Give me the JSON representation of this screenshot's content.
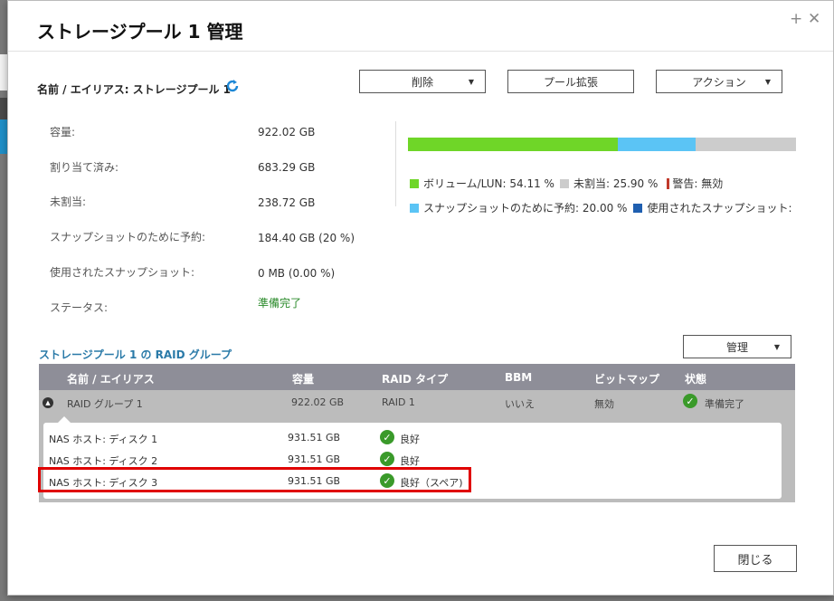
{
  "dialog": {
    "title": "ストレージプール 1 管理",
    "alias_line": "名前 / エイリアス: ストレージプール 1"
  },
  "toolbar": {
    "delete_label": "削除",
    "expand_label": "プール拡張",
    "action_label": "アクション"
  },
  "info": [
    {
      "label": "容量:",
      "value": "922.02 GB"
    },
    {
      "label": "割り当て済み:",
      "value": "683.29 GB"
    },
    {
      "label": "未割当:",
      "value": "238.72 GB"
    },
    {
      "label": "スナップショットのために予約:",
      "value": "184.40 GB (20 %)"
    },
    {
      "label": "使用されたスナップショット:",
      "value": "0 MB (0.00 %)"
    },
    {
      "label": "ステータス:",
      "value": "準備完了"
    }
  ],
  "usage_bar": {
    "volume_fraction": 0.5411,
    "unallocated_fraction": 0.259,
    "snapshot_reserved_fraction": 0.2,
    "colors": {
      "volume": "#6fd628",
      "snapshot_reserved": "#5bc4f5",
      "unallocated": "#cccccc",
      "warning": "#c0392b",
      "used_snapshot": "#1f5fb0"
    }
  },
  "legend": {
    "volume": "ボリューム/LUN: 54.11 %",
    "unallocated": "未割当: 25.90 %",
    "warning": "警告: 無効",
    "snapshot_reserved": "スナップショットのために予約: 20.00 %",
    "used_snapshot": "使用されたスナップショット:"
  },
  "raid_section": {
    "title": "ストレージプール 1 の RAID グループ",
    "manage_label": "管理",
    "headers": {
      "name": "名前 / エイリアス",
      "capacity": "容量",
      "raid_type": "RAID タイプ",
      "bbm": "BBM",
      "bitmap": "ビットマップ",
      "status": "状態"
    },
    "group": {
      "name": "RAID グループ 1",
      "capacity": "922.02 GB",
      "raid_type": "RAID 1",
      "bbm": "いいえ",
      "bitmap": "無効",
      "status": "準備完了"
    },
    "disks": [
      {
        "name": "NAS ホスト: ディスク 1",
        "capacity": "931.51 GB",
        "status": "良好"
      },
      {
        "name": "NAS ホスト: ディスク 2",
        "capacity": "931.51 GB",
        "status": "良好"
      },
      {
        "name": "NAS ホスト: ディスク 3",
        "capacity": "931.51 GB",
        "status": "良好（スペア)"
      }
    ]
  },
  "footer": {
    "close_label": "閉じる"
  }
}
